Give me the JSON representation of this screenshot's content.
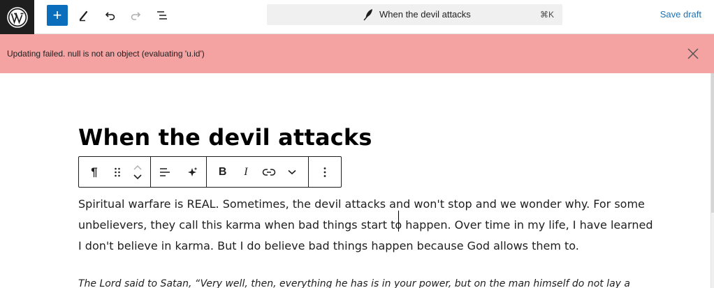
{
  "header": {
    "add_block_label": "+",
    "command_bar": {
      "title": "When the devil attacks",
      "shortcut": "⌘K"
    },
    "save_draft_label": "Save draft"
  },
  "notice": {
    "message": "Updating failed. null is not an object (evaluating 'u.id')"
  },
  "post": {
    "title": "When the devil attacks",
    "paragraph_lines": [
      "Spiritual warfare is REAL.  Sometimes, the devil attacks and won't stop and we wonder why.  For some",
      "unbelievers, they call this karma when bad things start to happen.  Over time in my life, I have learned",
      "I don't believe in karma.  But I do believe bad things happen because God allows them to."
    ],
    "quote_partial": "The Lord said to Satan, “Very well, then, everything he has is in your power, but on the man himself do not lay a"
  },
  "block_toolbar": {
    "paragraph_icon": "¶",
    "bold_label": "B",
    "italic_label": "I"
  },
  "colors": {
    "accent": "#0a6ebd",
    "notice_bg": "#f4a2a2",
    "link": "#2271b1"
  }
}
